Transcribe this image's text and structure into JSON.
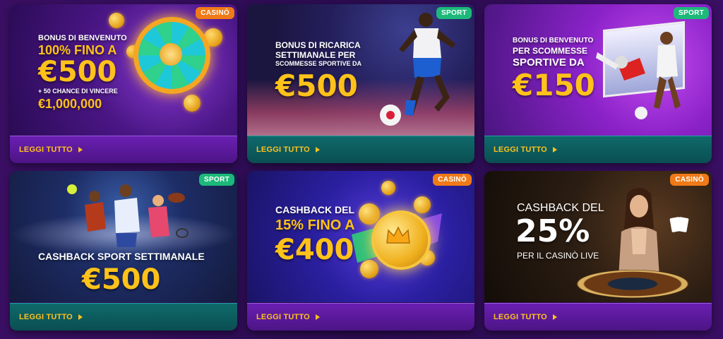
{
  "cards": [
    {
      "badge": "CASINÒ",
      "badge_color": "#f07a18",
      "lines": [
        "BONUS DI BENVENUTO",
        "100% FINO A",
        "€500",
        "+ 50 CHANCE DI VINCERE",
        "€1,000,000"
      ],
      "link": "LEGGI TUTTO"
    },
    {
      "badge": "SPORT",
      "badge_color": "#1db97a",
      "lines": [
        "BONUS DI RICARICA",
        "SETTIMANALE PER",
        "SCOMMESSE SPORTIVE DA",
        "€500"
      ],
      "link": "LEGGI TUTTO"
    },
    {
      "badge": "SPORT",
      "badge_color": "#1db97a",
      "lines": [
        "BONUS DI BENVENUTO",
        "PER SCOMMESSE",
        "SPORTIVE DA",
        "€150"
      ],
      "link": "LEGGI TUTTO"
    },
    {
      "badge": "SPORT",
      "badge_color": "#1db97a",
      "lines": [
        "CASHBACK SPORT SETTIMANALE",
        "€500"
      ],
      "link": "LEGGI TUTTO"
    },
    {
      "badge": "CASINÒ",
      "badge_color": "#f07a18",
      "lines": [
        "CASHBACK DEL",
        "15% FINO A",
        "€400"
      ],
      "link": "LEGGI TUTTO"
    },
    {
      "badge": "CASINÒ",
      "badge_color": "#f07a18",
      "lines": [
        "CASHBACK DEL",
        "25%",
        "PER IL CASINÒ LIVE"
      ],
      "link": "LEGGI TUTTO"
    }
  ],
  "icons": {
    "link_arrow": "play-triangle-icon"
  }
}
